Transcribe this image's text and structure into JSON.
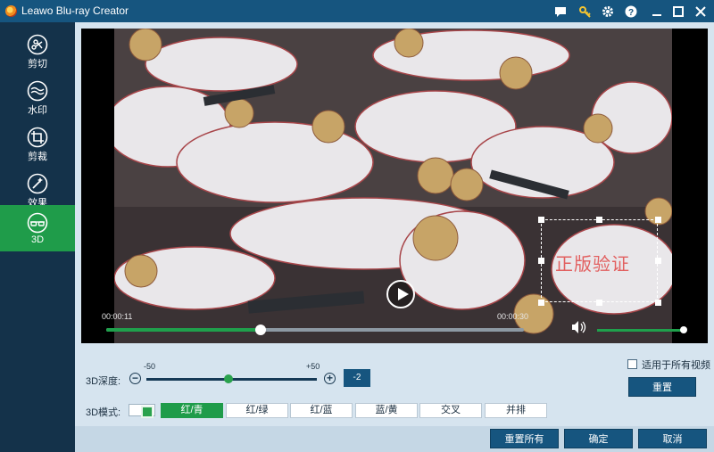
{
  "app": {
    "title": "Leawo Blu-ray Creator"
  },
  "titlebar_icons": [
    "message-icon",
    "key-icon",
    "gear-icon",
    "help-icon",
    "minimize-icon",
    "maximize-icon",
    "close-icon"
  ],
  "sidebar": {
    "items": [
      {
        "label": "剪切",
        "icon": "scissors-icon"
      },
      {
        "label": "水印",
        "icon": "watermark-icon"
      },
      {
        "label": "剪裁",
        "icon": "crop-icon"
      },
      {
        "label": "效果",
        "icon": "effect-icon"
      },
      {
        "label": "3D",
        "icon": "3d-glasses-icon",
        "active": true
      }
    ]
  },
  "player": {
    "current_time": "00:00:11",
    "total_time": "00:00:30",
    "progress_fraction": 0.37,
    "volume_fraction": 1.0,
    "watermark_text": "正版验证"
  },
  "depth": {
    "label": "3D深度:",
    "min_label": "-50",
    "max_label": "+50",
    "minus": "−",
    "plus": "+",
    "value": "-2",
    "knob_fraction": 0.48
  },
  "mode": {
    "label": "3D模式:",
    "options": [
      "红/青",
      "红/绿",
      "红/蓝",
      "蓝/黄",
      "交叉",
      "并排"
    ],
    "selected": "红/青"
  },
  "apply_all": {
    "label": "适用于所有视频",
    "checked": false
  },
  "buttons": {
    "reset": "重置",
    "reset_all": "重置所有",
    "ok": "确定",
    "cancel": "取消"
  },
  "colors": {
    "accent_green": "#1f9c4a",
    "brand_blue": "#16557f",
    "sidebar_bg": "#14324a"
  }
}
